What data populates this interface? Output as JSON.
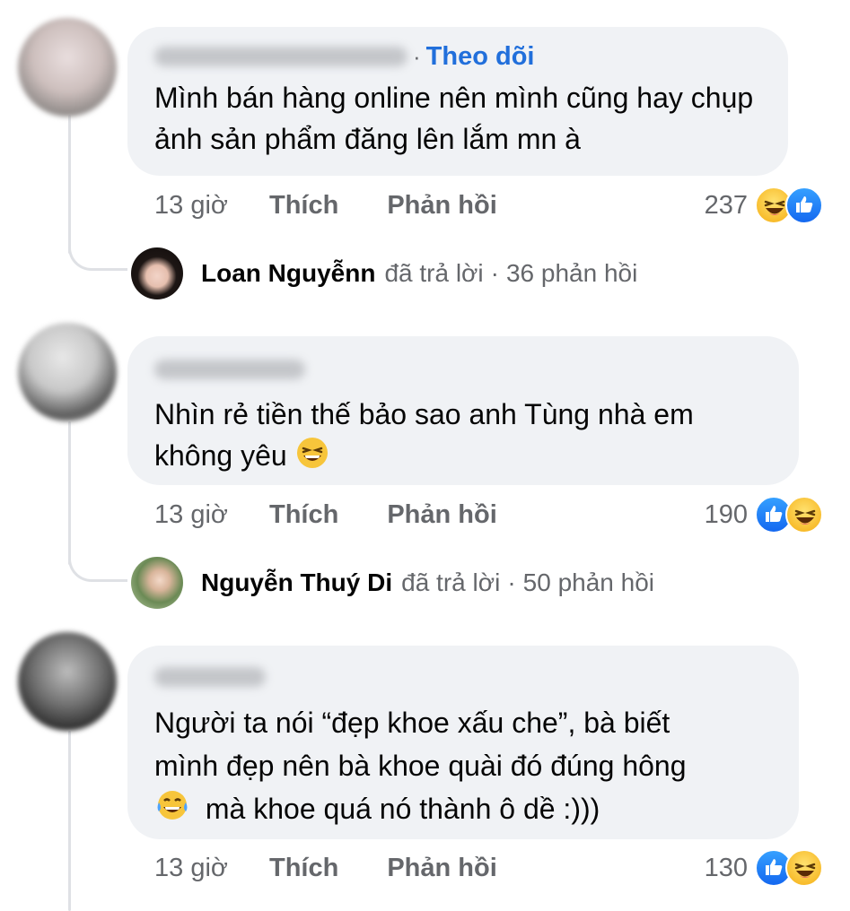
{
  "comments": [
    {
      "author_blurred": true,
      "follow_label": "Theo dõi",
      "separator": "·",
      "text": "Mình bán hàng online nên mình cũng hay chụp ảnh sản phẩm đăng lên lắm mn à",
      "time": "13 giờ",
      "like_label": "Thích",
      "reply_label": "Phản hồi",
      "reaction_count": "237",
      "reactions": [
        "haha-icon",
        "like-icon"
      ],
      "reply_summary": {
        "name": "Loan Nguyễnn",
        "action": "đã trả lời",
        "separator": "·",
        "count": "36 phản hồi"
      }
    },
    {
      "author_blurred": true,
      "text_line1": "Nhìn rẻ tiền thế bảo sao anh Tùng nhà em",
      "text_line2": "không yêu",
      "time": "13 giờ",
      "like_label": "Thích",
      "reply_label": "Phản hồi",
      "reaction_count": "190",
      "reactions": [
        "like-icon",
        "haha-icon"
      ],
      "reply_summary": {
        "name": "Nguyễn Thuý Di",
        "action": "đã trả lời",
        "separator": "·",
        "count": "50 phản hồi"
      }
    },
    {
      "author_blurred": true,
      "text_line1": "Người ta nói “đẹp khoe xấu che”, bà biết",
      "text_line2": "mình đẹp nên bà khoe quài đó đúng hông",
      "text_line3": "mà khoe quá nó thành ô dề :)))",
      "time": "13 giờ",
      "like_label": "Thích",
      "reply_label": "Phản hồi",
      "reaction_count": "130",
      "reactions": [
        "like-icon",
        "haha-icon"
      ]
    }
  ],
  "colors": {
    "bubble": "#f0f2f5",
    "link": "#216fdb",
    "meta": "#65676b",
    "text": "#050505"
  }
}
